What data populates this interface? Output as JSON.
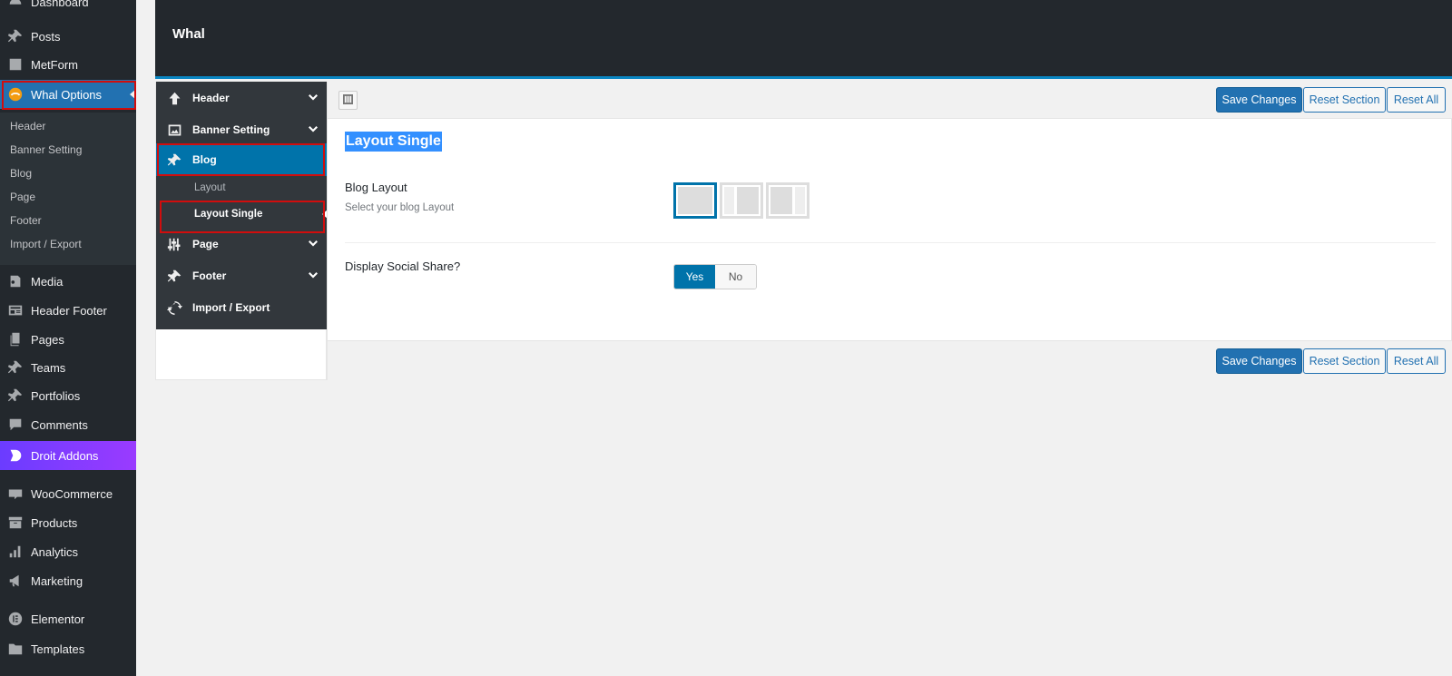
{
  "wp_menu": {
    "items": [
      {
        "label": "Dashboard",
        "icon": "dashboard-icon"
      },
      {
        "label": "Posts",
        "icon": "pin-icon"
      },
      {
        "label": "MetForm",
        "icon": "form-icon"
      },
      {
        "label": "Whal Options",
        "icon": "whal-logo-icon"
      },
      {
        "label": "Media",
        "icon": "media-icon"
      },
      {
        "label": "Header Footer",
        "icon": "header-footer-icon"
      },
      {
        "label": "Pages",
        "icon": "pages-icon"
      },
      {
        "label": "Teams",
        "icon": "pin-icon"
      },
      {
        "label": "Portfolios",
        "icon": "pin-icon"
      },
      {
        "label": "Comments",
        "icon": "comment-icon"
      },
      {
        "label": "Droit Addons",
        "icon": "droit-logo-icon"
      },
      {
        "label": "WooCommerce",
        "icon": "woo-icon"
      },
      {
        "label": "Products",
        "icon": "archive-icon"
      },
      {
        "label": "Analytics",
        "icon": "bar-chart-icon"
      },
      {
        "label": "Marketing",
        "icon": "megaphone-icon"
      },
      {
        "label": "Elementor",
        "icon": "elementor-icon"
      },
      {
        "label": "Templates",
        "icon": "folder-icon"
      }
    ],
    "submenu": [
      "Header",
      "Banner Setting",
      "Blog",
      "Page",
      "Footer",
      "Import / Export"
    ]
  },
  "header": {
    "title": "Whal"
  },
  "options_menu": {
    "items": [
      {
        "label": "Header",
        "icon": "arrow-up-icon"
      },
      {
        "label": "Banner Setting",
        "icon": "image-icon"
      },
      {
        "label": "Blog",
        "icon": "pin-icon"
      },
      {
        "label": "Page",
        "icon": "sliders-icon"
      },
      {
        "label": "Footer",
        "icon": "pin-icon"
      },
      {
        "label": "Import / Export",
        "icon": "refresh-icon"
      }
    ],
    "blog_sub": [
      "Layout",
      "Layout Single"
    ]
  },
  "toolbar": {
    "save_label": "Save Changes",
    "reset_section_label": "Reset Section",
    "reset_all_label": "Reset All"
  },
  "section": {
    "title": "Layout Single",
    "blog_layout": {
      "label": "Blog Layout",
      "desc": "Select your blog Layout",
      "options": [
        "full-width",
        "left-sidebar",
        "right-sidebar"
      ],
      "selected": "full-width"
    },
    "social_share": {
      "label": "Display Social Share?",
      "yes": "Yes",
      "no": "No",
      "value": "Yes"
    }
  },
  "colors": {
    "accent": "#0073aa",
    "highlight": "#d10d0d",
    "droit": "#7e3bff"
  }
}
